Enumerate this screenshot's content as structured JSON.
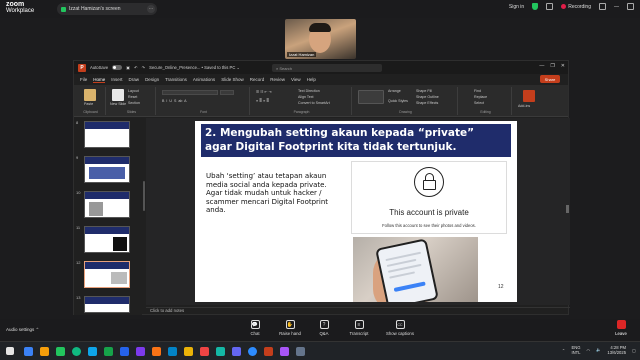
{
  "zoom": {
    "logo_line1": "zoom",
    "logo_line2": "Workplace",
    "share_label": "Izzat Hamizan's screen",
    "signin": "Sign in",
    "recording": "Recording",
    "participant_name": "Izzat Hamizan",
    "audio_settings": "Audio settings",
    "toolbar": [
      {
        "label": "Chat",
        "icon": "chat-icon",
        "glyph": "💬"
      },
      {
        "label": "Raise hand",
        "icon": "hand-icon",
        "glyph": "✋"
      },
      {
        "label": "Q&A",
        "icon": "qa-icon",
        "glyph": "?"
      },
      {
        "label": "Transcript",
        "icon": "transcript-icon",
        "glyph": "≡"
      },
      {
        "label": "Show captions",
        "icon": "cc-icon",
        "glyph": "CC"
      }
    ],
    "leave": "Leave"
  },
  "ppt": {
    "autosave": "AutoSave",
    "file_title": "Secure_Online_Presence... • Saved to this PC ⌄",
    "search_placeholder": "Search",
    "menu": [
      "File",
      "Home",
      "Insert",
      "Draw",
      "Design",
      "Transitions",
      "Animations",
      "Slide Show",
      "Record",
      "Review",
      "View",
      "Help"
    ],
    "menu_active": "Home",
    "share": "Share",
    "ribbon": {
      "paste": "Paste",
      "clipboard": "Clipboard",
      "new_slide": "New Slide",
      "layout": "Layout",
      "reset": "Reset",
      "section": "Section",
      "slides": "Slides",
      "font": "Font",
      "paragraph": "Paragraph",
      "text_direction": "Text Direction",
      "align_text": "Align Text",
      "convert_smartart": "Convert to SmartArt",
      "arrange": "Arrange",
      "quick_styles": "Quick Styles",
      "drawing": "Drawing",
      "shape_fill": "Shape Fill",
      "shape_outline": "Shape Outline",
      "shape_effects": "Shape Effects",
      "find": "Find",
      "replace": "Replace",
      "select": "Select",
      "editing": "Editing",
      "addins": "Add-ins"
    },
    "thumb_numbers": [
      "8",
      "9",
      "10",
      "11",
      "12",
      "13"
    ],
    "notes_placeholder": "Click to add notes"
  },
  "slide": {
    "title_line1": "2. Mengubah setting akaun kepada “private”",
    "title_line2": "agar Digital Footprint kita tidak tertunjuk.",
    "body": "Ubah ‘setting’ atau tetapan akaun media social anda kepada private. Agar tidak mudah untuk hacker / scammer mencari Digital Footprint anda.",
    "private_title": "This account is private",
    "private_sub": "Follow this account to see their photos and videos.",
    "slide_number": "12"
  },
  "taskbar": {
    "lang1": "ENG",
    "lang2": "INTL",
    "time": "4:28 PM",
    "date": "13/6/2025"
  },
  "colors": {
    "accent": "#c43e1c",
    "slide_title_bg": "#1f2c6b",
    "recording": "#e11d48",
    "leave": "#dc2626"
  }
}
